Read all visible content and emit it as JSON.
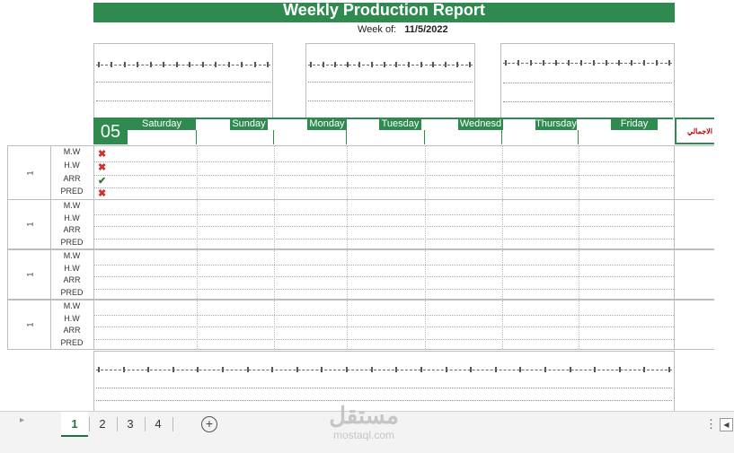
{
  "report": {
    "title": "Weekly Production Report",
    "week_of_label": "Week of:",
    "week_of_value": "11/5/2022",
    "day_number": "05",
    "total_label": "الاجمالي"
  },
  "days": [
    "Saturday",
    "Sunday",
    "Monday",
    "Tuesday",
    "Wednesd",
    "Thursday",
    "Friday"
  ],
  "metrics": [
    "M.W",
    "H.W",
    "ARR",
    "PRED"
  ],
  "blocks": [
    {
      "label": "1",
      "marks": [
        "x",
        "x",
        "check",
        "x"
      ]
    },
    {
      "label": "1",
      "marks": []
    },
    {
      "label": "1",
      "marks": []
    },
    {
      "label": "1",
      "marks": []
    }
  ],
  "icons": {
    "x": "close-x-icon",
    "check": "check-icon"
  },
  "colors": {
    "accent": "#2f8a4f",
    "cross": "#d32f2f",
    "check": "#2e7d32",
    "total_text": "#cc0000"
  },
  "sheet_tabs": [
    "1",
    "2",
    "3",
    "4"
  ],
  "active_tab": "1",
  "watermark": {
    "arabic": "مستقل",
    "latin": "mostaql.com"
  }
}
